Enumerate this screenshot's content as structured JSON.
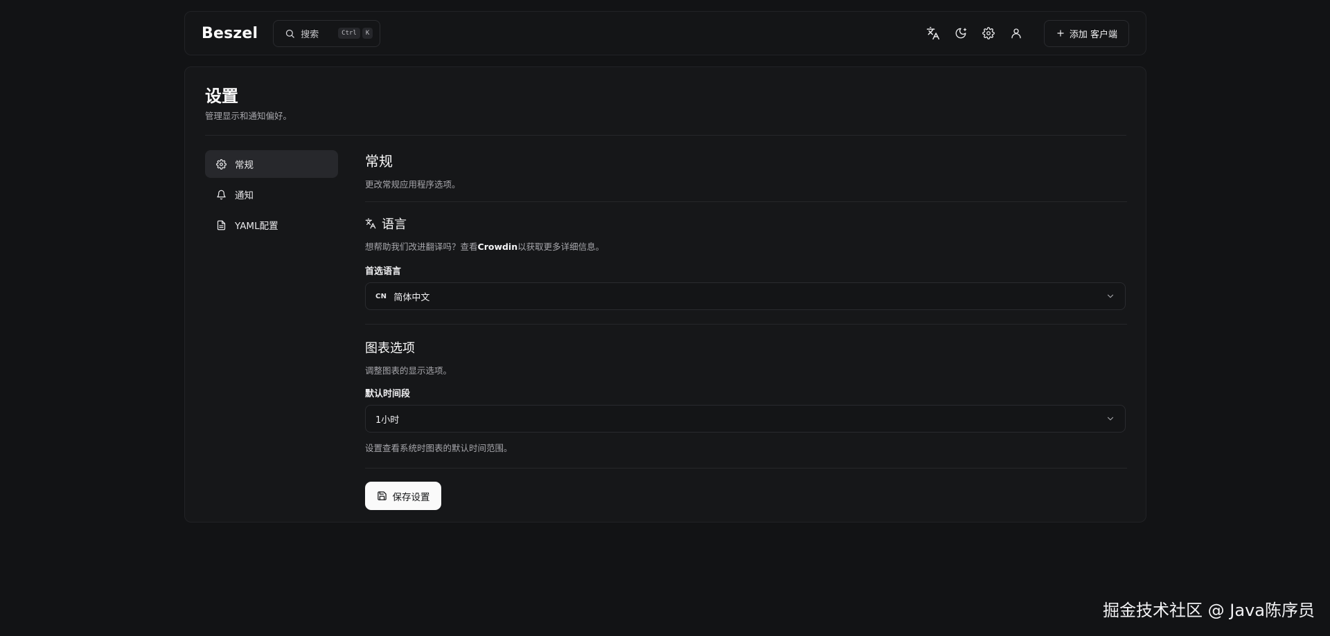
{
  "header": {
    "logo": "Beszel",
    "search_label": "搜索",
    "search_kbd": [
      "Ctrl",
      "K"
    ],
    "add_button_label": "添加 客户端"
  },
  "page": {
    "title": "设置",
    "subtitle": "管理显示和通知偏好。"
  },
  "sidebar": {
    "items": [
      {
        "label": "常规",
        "icon": "gear-icon",
        "active": true
      },
      {
        "label": "通知",
        "icon": "bell-icon",
        "active": false
      },
      {
        "label": "YAML配置",
        "icon": "file-icon",
        "active": false
      }
    ]
  },
  "general": {
    "title": "常规",
    "subtitle": "更改常规应用程序选项。"
  },
  "language": {
    "title": "语言",
    "help_prefix": "想帮助我们改进翻译吗？查看",
    "help_link": "Crowdin",
    "help_suffix": "以获取更多详细信息。",
    "field_label": "首选语言",
    "badge": "CN",
    "selected": "简体中文"
  },
  "chart_options": {
    "title": "图表选项",
    "subtitle": "调整图表的显示选项。",
    "field_label": "默认时间段",
    "selected": "1小时",
    "help": "设置查看系统时图表的默认时间范围。"
  },
  "save_button_label": "保存设置",
  "watermark": "掘金技术社区 @ Java陈序员"
}
